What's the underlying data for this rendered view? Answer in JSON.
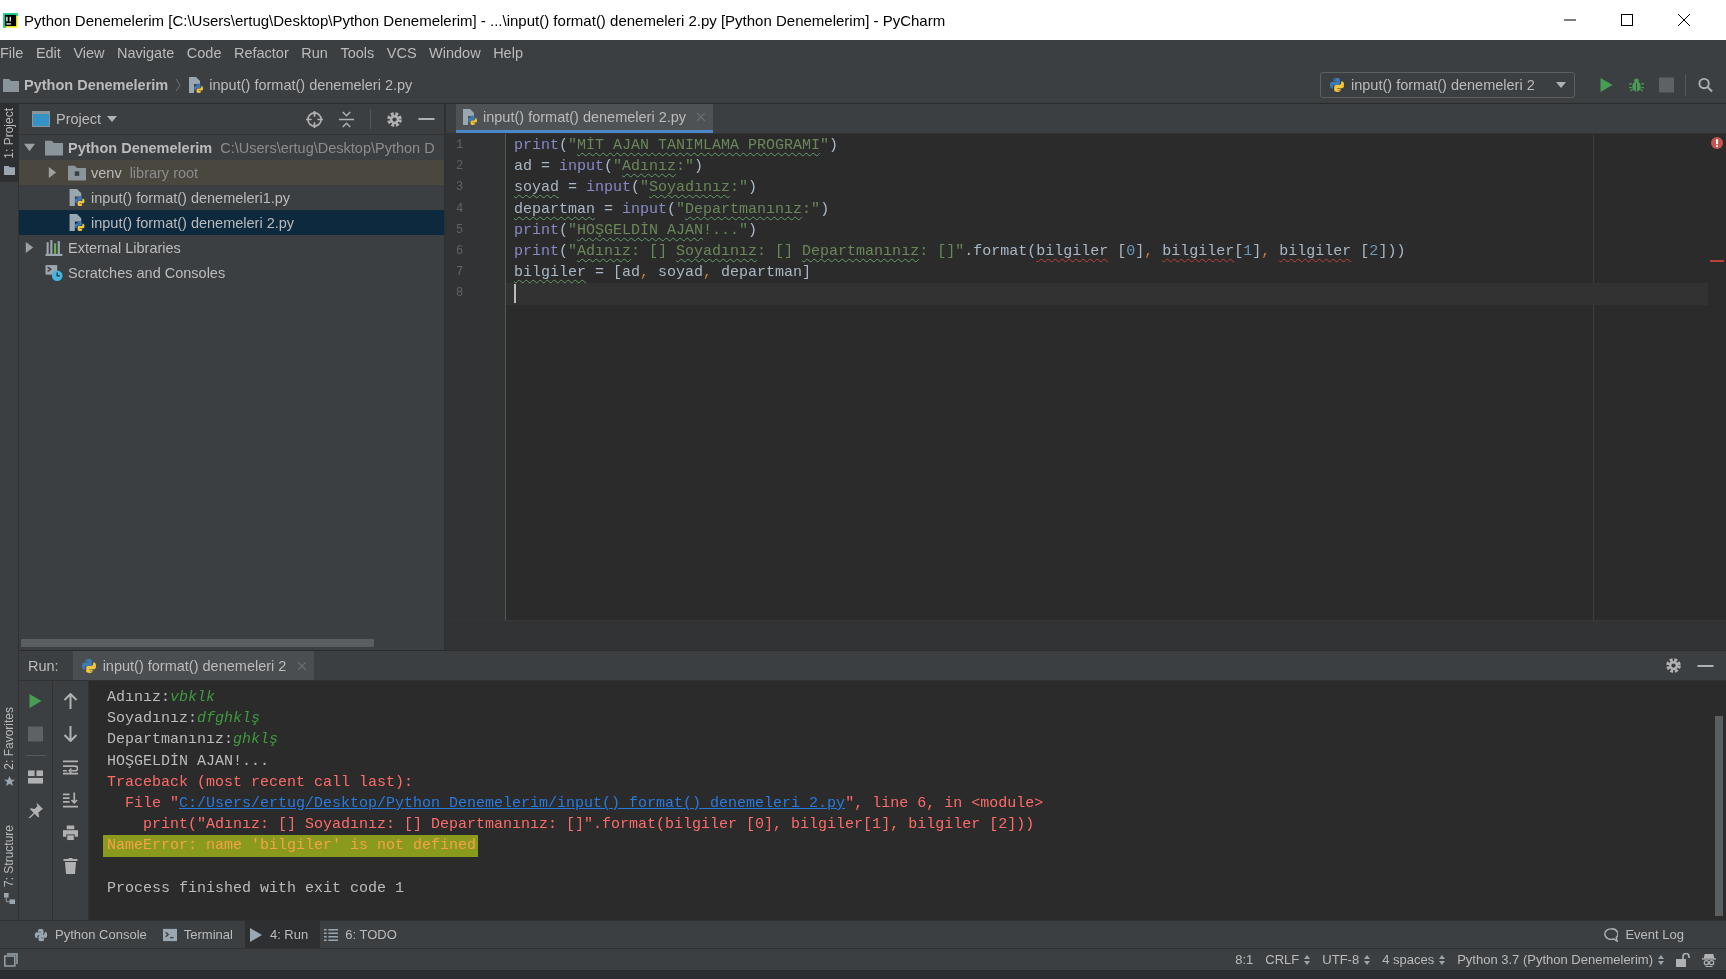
{
  "window": {
    "title": "Python Denemelerim [C:\\Users\\ertug\\Desktop\\Python Denemelerim] - ...\\input() format() denemeleri 2.py [Python Denemelerim] - PyCharm"
  },
  "menu": [
    "File",
    "Edit",
    "View",
    "Navigate",
    "Code",
    "Refactor",
    "Run",
    "Tools",
    "VCS",
    "Window",
    "Help"
  ],
  "navbar": {
    "breadcrumbs": [
      {
        "label": "Python Denemelerim",
        "kind": "project"
      },
      {
        "label": "input() format() denemeleri 2.py",
        "kind": "python-file"
      }
    ],
    "run_config": "input() format() denemeleri 2",
    "actions": [
      {
        "kind": "run",
        "disabled": false
      },
      {
        "kind": "debug",
        "disabled": false
      },
      {
        "kind": "stop",
        "disabled": true
      },
      {
        "kind": "search",
        "disabled": false
      }
    ]
  },
  "left_stripe": {
    "top": [
      {
        "label": "1: Project",
        "kind": "project",
        "selected": true
      }
    ],
    "bottom": [
      {
        "label": "2: Favorites",
        "kind": "favorites",
        "selected": false
      },
      {
        "label": "7: Structure",
        "kind": "structure",
        "selected": false
      }
    ]
  },
  "project_panel": {
    "title": "Project",
    "tree": [
      {
        "label": "Python Denemelerim",
        "hint": "C:\\Users\\ertug\\Desktop\\Python D",
        "kind": "project-root",
        "expanded": true,
        "selected": false,
        "children": [
          {
            "label": "venv",
            "hint": "library root",
            "kind": "library-root",
            "expanded": false,
            "selected": false
          },
          {
            "label": "input() format() denemeleri1.py",
            "kind": "python-file",
            "selected": false
          },
          {
            "label": "input() format() denemeleri 2.py",
            "kind": "python-file",
            "selected": true
          }
        ]
      },
      {
        "label": "External Libraries",
        "kind": "libraries",
        "expanded": false,
        "selected": false
      },
      {
        "label": "Scratches and Consoles",
        "kind": "scratches",
        "selected": false
      }
    ]
  },
  "editor": {
    "tabs": [
      {
        "label": "input() format() denemeleri 2.py",
        "selected": true
      }
    ],
    "lines": [
      {
        "number": "1",
        "current": false,
        "tokens": [
          {
            "text": "print",
            "kind": "builtin"
          },
          {
            "text": "(",
            "kind": "plain"
          },
          {
            "text": "\"",
            "kind": "string"
          },
          {
            "text": "MİT AJAN TANIMLAMA PROGRAMI",
            "kind": "string-misspelled"
          },
          {
            "text": "\"",
            "kind": "string"
          },
          {
            "text": ")",
            "kind": "plain"
          }
        ]
      },
      {
        "number": "2",
        "current": false,
        "tokens": [
          {
            "text": "ad = ",
            "kind": "plain"
          },
          {
            "text": "input",
            "kind": "builtin"
          },
          {
            "text": "(",
            "kind": "plain"
          },
          {
            "text": "\"",
            "kind": "string"
          },
          {
            "text": "Adınız",
            "kind": "string-misspelled"
          },
          {
            "text": ":\"",
            "kind": "string"
          },
          {
            "text": ")",
            "kind": "plain"
          }
        ]
      },
      {
        "number": "3",
        "current": false,
        "tokens": [
          {
            "text": "soyad",
            "kind": "name-misspelled"
          },
          {
            "text": " = ",
            "kind": "plain"
          },
          {
            "text": "input",
            "kind": "builtin"
          },
          {
            "text": "(",
            "kind": "plain"
          },
          {
            "text": "\"",
            "kind": "string"
          },
          {
            "text": "Soyadınız",
            "kind": "string-misspelled"
          },
          {
            "text": ":\"",
            "kind": "string"
          },
          {
            "text": ")",
            "kind": "plain"
          }
        ]
      },
      {
        "number": "4",
        "current": false,
        "tokens": [
          {
            "text": "departman",
            "kind": "name-misspelled"
          },
          {
            "text": " = ",
            "kind": "plain"
          },
          {
            "text": "input",
            "kind": "builtin"
          },
          {
            "text": "(",
            "kind": "plain"
          },
          {
            "text": "\"",
            "kind": "string"
          },
          {
            "text": "Departmanınız",
            "kind": "string-misspelled"
          },
          {
            "text": ":\"",
            "kind": "string"
          },
          {
            "text": ")",
            "kind": "plain"
          }
        ]
      },
      {
        "number": "5",
        "current": false,
        "tokens": [
          {
            "text": "print",
            "kind": "builtin"
          },
          {
            "text": "(",
            "kind": "plain"
          },
          {
            "text": "\"",
            "kind": "string"
          },
          {
            "text": "HOŞGELDİN AJAN",
            "kind": "string-misspelled"
          },
          {
            "text": "!...\"",
            "kind": "string"
          },
          {
            "text": ")",
            "kind": "plain"
          }
        ]
      },
      {
        "number": "6",
        "current": false,
        "tokens": [
          {
            "text": "print",
            "kind": "builtin"
          },
          {
            "text": "(",
            "kind": "plain"
          },
          {
            "text": "\"",
            "kind": "string"
          },
          {
            "text": "Adınız",
            "kind": "string-misspelled"
          },
          {
            "text": ": [] ",
            "kind": "string"
          },
          {
            "text": "Soyadınız",
            "kind": "string-misspelled"
          },
          {
            "text": ": [] ",
            "kind": "string"
          },
          {
            "text": "Departmanınız",
            "kind": "string-misspelled"
          },
          {
            "text": ": []\"",
            "kind": "string"
          },
          {
            "text": ".format(",
            "kind": "plain"
          },
          {
            "text": "bilgiler",
            "kind": "name-unresolved"
          },
          {
            "text": " [",
            "kind": "plain"
          },
          {
            "text": "0",
            "kind": "number"
          },
          {
            "text": "]",
            "kind": "plain"
          },
          {
            "text": ", ",
            "kind": "comma"
          },
          {
            "text": "bilgiler",
            "kind": "name-unresolved"
          },
          {
            "text": "[",
            "kind": "plain"
          },
          {
            "text": "1",
            "kind": "number"
          },
          {
            "text": "]",
            "kind": "plain"
          },
          {
            "text": ", ",
            "kind": "comma"
          },
          {
            "text": "bilgiler",
            "kind": "name-unresolved"
          },
          {
            "text": " [",
            "kind": "plain"
          },
          {
            "text": "2",
            "kind": "number"
          },
          {
            "text": "]))",
            "kind": "plain"
          }
        ]
      },
      {
        "number": "7",
        "current": false,
        "tokens": [
          {
            "text": "bilgiler",
            "kind": "name-misspelled"
          },
          {
            "text": " = [ad",
            "kind": "plain"
          },
          {
            "text": ", ",
            "kind": "comma"
          },
          {
            "text": "soyad",
            "kind": "plain"
          },
          {
            "text": ", ",
            "kind": "comma"
          },
          {
            "text": "departman]",
            "kind": "plain"
          }
        ]
      },
      {
        "number": "8",
        "current": true
      }
    ]
  },
  "run_panel": {
    "title": "Run:",
    "tabs": [
      {
        "label": "input() format() denemeleri 2",
        "selected": true
      }
    ],
    "toolbar": [
      {
        "kind": "rerun",
        "disabled": false
      },
      {
        "kind": "stop",
        "disabled": true
      },
      {
        "kind": "layout",
        "disabled": false
      },
      {
        "kind": "pin",
        "disabled": false
      }
    ],
    "console": {
      "lines": [
        {
          "highlighted": false,
          "segments": [
            {
              "text": "Adınız:",
              "kind": "output"
            },
            {
              "text": "vbklk",
              "kind": "input"
            }
          ]
        },
        {
          "highlighted": false,
          "segments": [
            {
              "text": "Soyadınız:",
              "kind": "output"
            },
            {
              "text": "dfghklş",
              "kind": "input"
            }
          ]
        },
        {
          "highlighted": false,
          "segments": [
            {
              "text": "Departmanınız:",
              "kind": "output"
            },
            {
              "text": "ghklş",
              "kind": "input"
            }
          ]
        },
        {
          "highlighted": false,
          "segments": [
            {
              "text": "HOŞGELDİN AJAN!...",
              "kind": "output"
            }
          ]
        },
        {
          "highlighted": false,
          "segments": [
            {
              "text": "Traceback (most recent call last):",
              "kind": "error"
            }
          ]
        },
        {
          "highlighted": false,
          "segments": [
            {
              "text": "  File \"",
              "kind": "error"
            },
            {
              "text": "C:/Users/ertug/Desktop/Python Denemelerim/input() format() denemeleri 2.py",
              "kind": "link"
            },
            {
              "text": "\", line 6, in <module>",
              "kind": "error"
            }
          ]
        },
        {
          "highlighted": false,
          "segments": [
            {
              "text": "    print(\"Adınız: [] Soyadınız: [] Departmanınız: []\".format(bilgiler [0], bilgiler[1], bilgiler [2]))",
              "kind": "error"
            }
          ]
        },
        {
          "highlighted": true,
          "segments": [
            {
              "text": "NameError: name 'bilgiler' is not defined",
              "kind": "error"
            }
          ]
        }
      ],
      "exit_message": "Process finished with exit code 1"
    }
  },
  "tool_windows": {
    "left": [
      {
        "label": "Python Console",
        "kind": "python",
        "selected": false
      },
      {
        "label": "Terminal",
        "kind": "terminal",
        "selected": false
      },
      {
        "label": "4: Run",
        "kind": "run",
        "selected": true
      },
      {
        "label": "6: TODO",
        "kind": "todo",
        "selected": false
      }
    ],
    "right": [
      {
        "label": "Event Log",
        "kind": "event-log",
        "selected": false
      }
    ]
  },
  "status_bar": {
    "items": [
      {
        "label": "8:1",
        "menu": false
      },
      {
        "label": "CRLF",
        "menu": true
      },
      {
        "label": "UTF-8",
        "menu": true
      },
      {
        "label": "4 spaces",
        "menu": true
      },
      {
        "label": "Python 3.7 (Python Denemelerim)",
        "menu": true
      }
    ]
  }
}
